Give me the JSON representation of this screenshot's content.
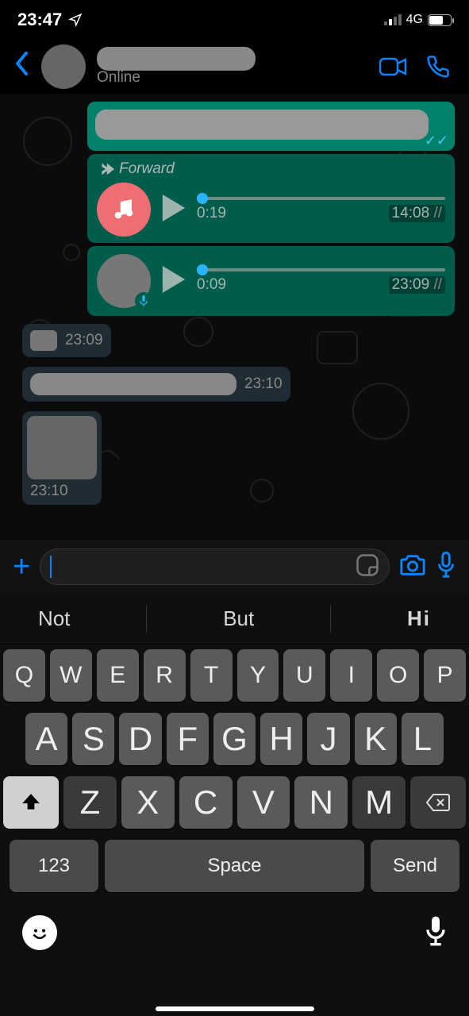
{
  "status": {
    "time": "23:47",
    "network": "4G"
  },
  "header": {
    "status": "Online"
  },
  "messages": {
    "fwd_label": "Forward",
    "audio1": {
      "elapsed": "0:19",
      "timestamp": "14:08"
    },
    "audio2": {
      "elapsed": "0:09",
      "timestamp": "23:09"
    },
    "in1_time": "23:09",
    "in2_time": "23:10",
    "in3_time": "23:10"
  },
  "keyboard": {
    "suggestions": [
      "Not",
      "But",
      "Hi"
    ],
    "row1": [
      "Q",
      "W",
      "E",
      "R",
      "T",
      "Y",
      "U",
      "I",
      "O",
      "P"
    ],
    "row2": [
      "A",
      "S",
      "D",
      "F",
      "G",
      "H",
      "J",
      "K",
      "L"
    ],
    "row3": [
      "Z",
      "X",
      "C",
      "V",
      "N",
      "M"
    ],
    "num": "123",
    "space": "Space",
    "send": "Send"
  }
}
